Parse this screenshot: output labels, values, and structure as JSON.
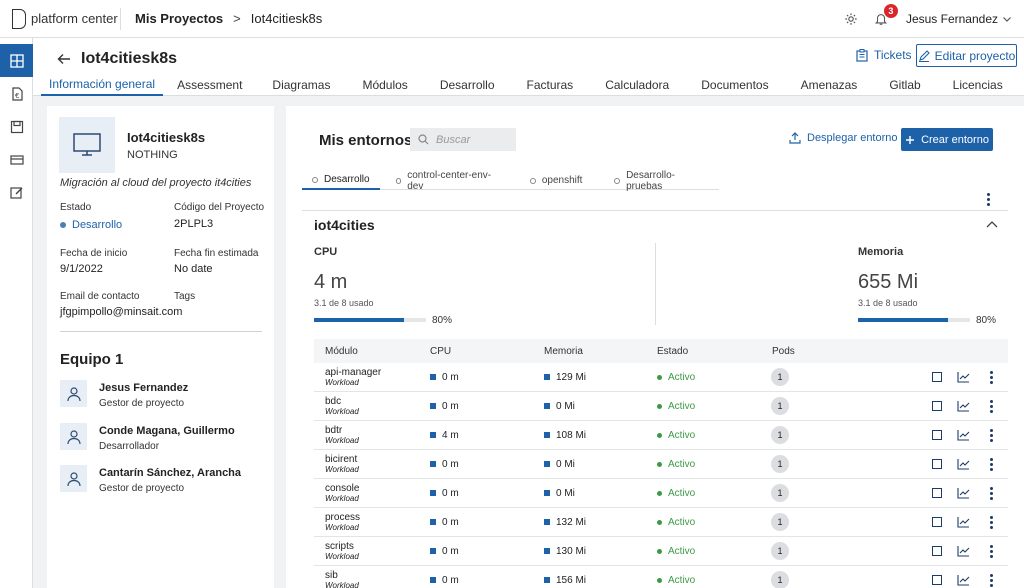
{
  "topbar": {
    "logo_text": "platform center",
    "breadcrumb_root": "Mis Proyectos",
    "breadcrumb_sep": ">",
    "breadcrumb_current": "Iot4citiesk8s",
    "notification_count": "3",
    "user_name": "Jesus Fernandez"
  },
  "rail": {
    "items": [
      "grid-icon",
      "euro-icon",
      "save-icon",
      "card-icon",
      "edit-icon"
    ]
  },
  "project": {
    "title": "Iot4citiesk8s",
    "tickets_label": "Tickets",
    "edit_label": "Editar proyecto"
  },
  "tabs": [
    "Información general",
    "Assessment",
    "Diagramas",
    "Módulos",
    "Desarrollo",
    "Facturas",
    "Calculadora",
    "Documentos",
    "Amenazas",
    "Gitlab",
    "Licencias"
  ],
  "info": {
    "name": "Iot4citiesk8s",
    "owner": "NOTHING",
    "description": "Migración al cloud del proyecto it4cities",
    "estado_label": "Estado",
    "estado_value": "Desarrollo",
    "codigo_label": "Código del Proyecto",
    "codigo_value": "2PLPL3",
    "inicio_label": "Fecha de inicio",
    "inicio_value": "9/1/2022",
    "fin_label": "Fecha fin estimada",
    "fin_value": "No date",
    "email_label": "Email de contacto",
    "email_value": "jfgpimpollo@minsait.com",
    "tags_label": "Tags",
    "team_title": "Equipo  1",
    "members": [
      {
        "name": "Jesus Fernandez",
        "role": "Gestor de proyecto"
      },
      {
        "name": "Conde Magana, Guillermo",
        "role": "Desarrollador"
      },
      {
        "name": "Cantarín Sánchez, Arancha",
        "role": "Gestor de proyecto"
      }
    ]
  },
  "environments": {
    "title": "Mis entornos",
    "search_placeholder": "Buscar",
    "deploy_label": "Desplegar entorno",
    "create_label": "Crear entorno",
    "tabs": [
      "Desarrollo",
      "control-center-env-dev",
      "openshift",
      "Desarrollo-pruebas"
    ],
    "env_name": "iot4cities",
    "cpu": {
      "label": "CPU",
      "value": "4 m",
      "sub": "3.1 de 8 usado",
      "pct_label": "80%",
      "pct": 0.8
    },
    "mem": {
      "label": "Memoria",
      "value": "655 Mi",
      "sub": "3.1 de 8 usado",
      "pct_label": "80%",
      "pct": 0.8
    },
    "table": {
      "headers": [
        "Módulo",
        "CPU",
        "Memoria",
        "Estado",
        "Pods"
      ],
      "rows": [
        {
          "name": "api-manager",
          "type": "Workload",
          "cpu": "0 m",
          "mem": "129 Mi",
          "estado": "Activo",
          "pods": "1"
        },
        {
          "name": "bdc",
          "type": "Workload",
          "cpu": "0 m",
          "mem": "0 Mi",
          "estado": "Activo",
          "pods": "1"
        },
        {
          "name": "bdtr",
          "type": "Workload",
          "cpu": "4 m",
          "mem": "108 Mi",
          "estado": "Activo",
          "pods": "1"
        },
        {
          "name": "bicirent",
          "type": "Workload",
          "cpu": "0 m",
          "mem": "0 Mi",
          "estado": "Activo",
          "pods": "1"
        },
        {
          "name": "console",
          "type": "Workload",
          "cpu": "0 m",
          "mem": "0 Mi",
          "estado": "Activo",
          "pods": "1"
        },
        {
          "name": "process",
          "type": "Workload",
          "cpu": "0 m",
          "mem": "132 Mi",
          "estado": "Activo",
          "pods": "1"
        },
        {
          "name": "scripts",
          "type": "Workload",
          "cpu": "0 m",
          "mem": "130 Mi",
          "estado": "Activo",
          "pods": "1"
        },
        {
          "name": "sib",
          "type": "Workload",
          "cpu": "0 m",
          "mem": "156 Mi",
          "estado": "Activo",
          "pods": "1"
        }
      ]
    }
  },
  "colors": {
    "accent": "#1d61a8",
    "active_green": "#3c9a47",
    "badge_red": "#d9262c"
  }
}
